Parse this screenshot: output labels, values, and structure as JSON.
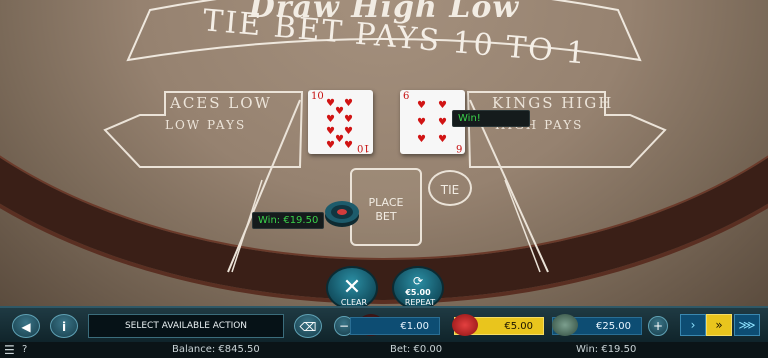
{
  "table": {
    "title": "Draw High Low",
    "tie_text": "TIE BET PAYS 10 TO 1",
    "left_zone": {
      "heading": "ACES LOW",
      "sub": "LOW PAYS"
    },
    "right_zone": {
      "heading": "KINGS HIGH",
      "sub": "HIGH PAYS"
    },
    "place_bet": "PLACE BET",
    "tie_label": "TIE",
    "cards": [
      {
        "rank": "10",
        "suit": "hearts"
      },
      {
        "rank": "6",
        "suit": "hearts"
      }
    ],
    "win_card": "Win!",
    "win_chip": "Win: €19.50"
  },
  "controls": {
    "clear_label": "CLEAR",
    "repeat_label": "REPEAT",
    "repeat_value": "€5.00"
  },
  "bar": {
    "message": "SELECT AVAILABLE ACTION",
    "stakes": [
      {
        "label": "€1.00",
        "selected": false
      },
      {
        "label": "€5.00",
        "selected": true
      },
      {
        "label": "€25.00",
        "selected": false
      }
    ]
  },
  "status": {
    "balance": "Balance: €845.50",
    "bet": "Bet: €0.00",
    "win": "Win: €19.50",
    "help": "?"
  },
  "colors": {
    "felt": "#968270",
    "rim": "#3a1f17",
    "accent": "#2b8ea3",
    "win_text": "#3ad14a",
    "selected_stake": "#e9c51d"
  }
}
